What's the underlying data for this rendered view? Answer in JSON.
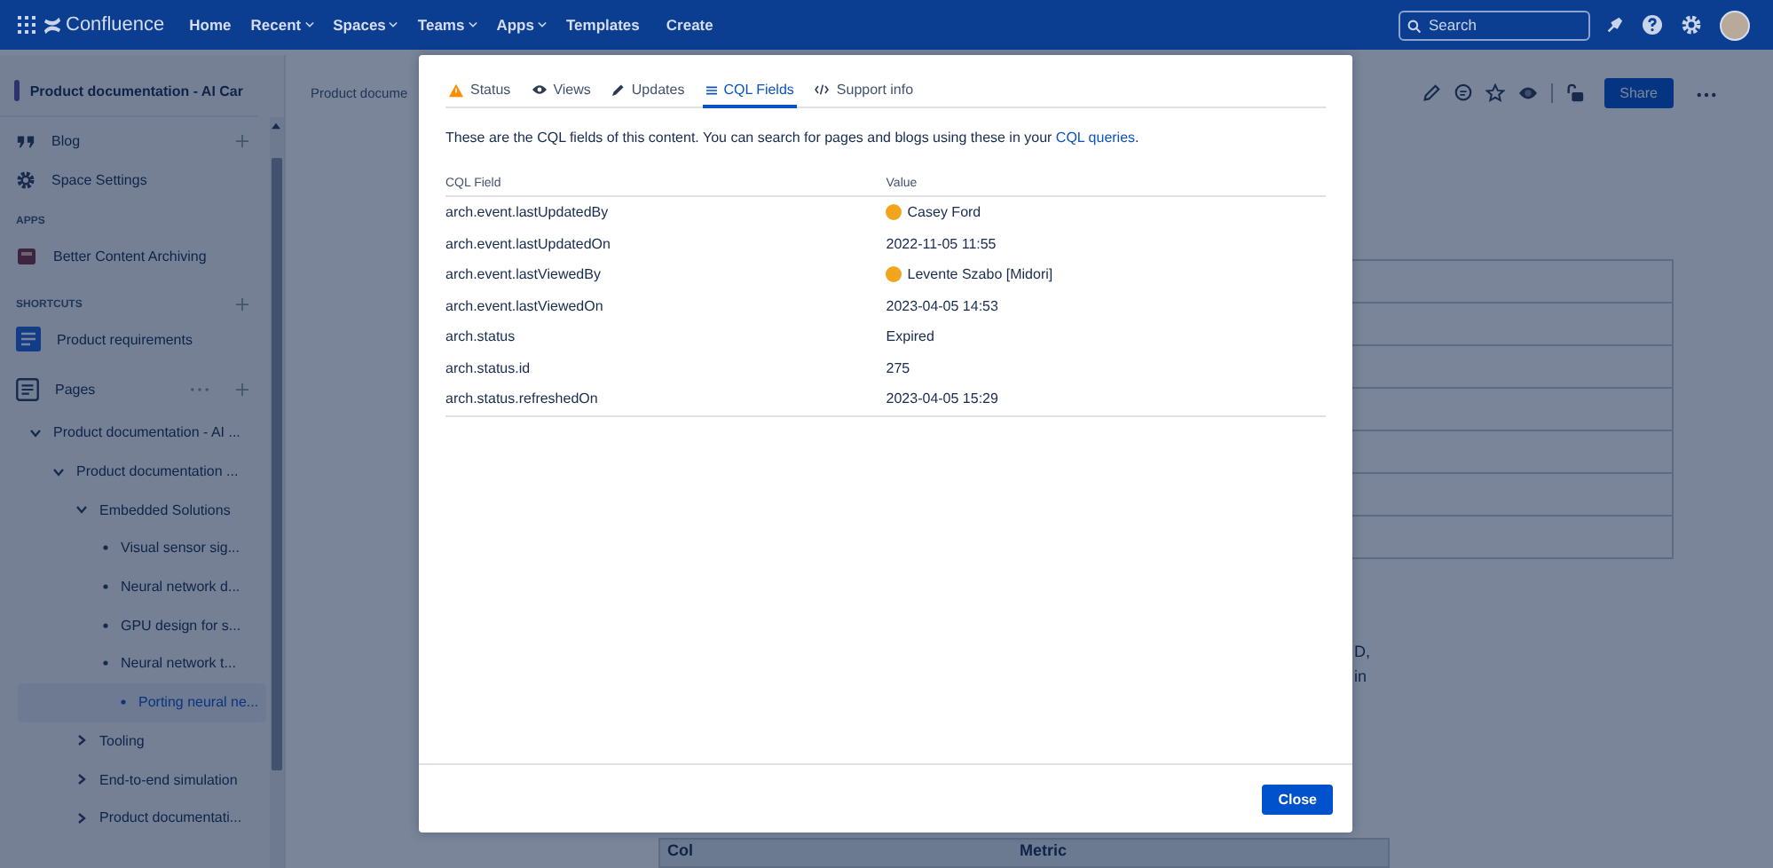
{
  "nav": {
    "logo": "Confluence",
    "items": [
      {
        "label": "Home",
        "dropdown": false
      },
      {
        "label": "Recent",
        "dropdown": true
      },
      {
        "label": "Spaces",
        "dropdown": true
      },
      {
        "label": "Teams",
        "dropdown": true
      },
      {
        "label": "Apps",
        "dropdown": true
      },
      {
        "label": "Templates",
        "dropdown": false
      }
    ],
    "create": "Create",
    "search": {
      "placeholder": "Search"
    }
  },
  "sidebar": {
    "space_title": "Product documentation - AI Car",
    "items": [
      {
        "label": "Blog",
        "kind": "blog"
      },
      {
        "label": "Space Settings",
        "kind": "settings"
      }
    ],
    "sections": [
      {
        "heading": "APPS",
        "items": [
          {
            "label": "Better Content Archiving",
            "kind": "app"
          }
        ]
      },
      {
        "heading": "SHORTCUTS",
        "items": [
          {
            "label": "Product requirements",
            "kind": "doc"
          }
        ]
      }
    ],
    "pages": {
      "label": "Pages",
      "tree": [
        {
          "label": "Product documentation - AI ...",
          "expanded": true,
          "selected": false,
          "children": [
            {
              "label": "Product documentation ...",
              "expanded": true,
              "selected": false,
              "children": [
                {
                  "label": "Embedded Solutions",
                  "expanded": true,
                  "selected": false,
                  "children": [
                    {
                      "label": "Visual sensor sig...",
                      "selected": false
                    },
                    {
                      "label": "Neural network d...",
                      "selected": false
                    },
                    {
                      "label": "GPU design for s...",
                      "selected": false
                    },
                    {
                      "label": "Neural network t...",
                      "selected": false
                    },
                    {
                      "label": "Porting neural ne...",
                      "selected": true
                    }
                  ]
                },
                {
                  "label": "Tooling",
                  "expanded": false,
                  "selected": false
                },
                {
                  "label": "End-to-end simulation",
                  "expanded": false,
                  "selected": false
                },
                {
                  "label": "Product documentati...",
                  "expanded": false,
                  "selected": false
                }
              ]
            }
          ]
        }
      ]
    }
  },
  "page": {
    "breadcrumb": "Product docume",
    "share": "Share",
    "fragments": [
      "D,",
      "in"
    ],
    "bottom_table": [
      "Col",
      "Metric"
    ]
  },
  "dialog": {
    "tabs": [
      {
        "label": "Status",
        "kind": "warning",
        "selected": false
      },
      {
        "label": "Views",
        "kind": "eye",
        "selected": false
      },
      {
        "label": "Updates",
        "kind": "pencil",
        "selected": false
      },
      {
        "label": "CQL Fields",
        "kind": "list",
        "selected": true
      },
      {
        "label": "Support info",
        "kind": "code",
        "selected": false
      }
    ],
    "intro": "These are the CQL fields of this content. You can search for pages and blogs using these in your ",
    "intro_link": "CQL queries",
    "intro_end": ".",
    "columns": [
      "CQL Field",
      "Value"
    ],
    "rows": [
      {
        "field": "arch.event.lastUpdatedBy",
        "value": "Casey Ford",
        "avatar": true
      },
      {
        "field": "arch.event.lastUpdatedOn",
        "value": "2022-11-05 11:55",
        "avatar": false
      },
      {
        "field": "arch.event.lastViewedBy",
        "value": "Levente Szabo [Midori]",
        "avatar": true
      },
      {
        "field": "arch.event.lastViewedOn",
        "value": "2023-04-05 14:53",
        "avatar": false
      },
      {
        "field": "arch.status",
        "value": "Expired",
        "avatar": false
      },
      {
        "field": "arch.status.id",
        "value": "275",
        "avatar": false
      },
      {
        "field": "arch.status.refreshedOn",
        "value": "2023-04-05 15:29",
        "avatar": false
      }
    ],
    "close": "Close"
  }
}
